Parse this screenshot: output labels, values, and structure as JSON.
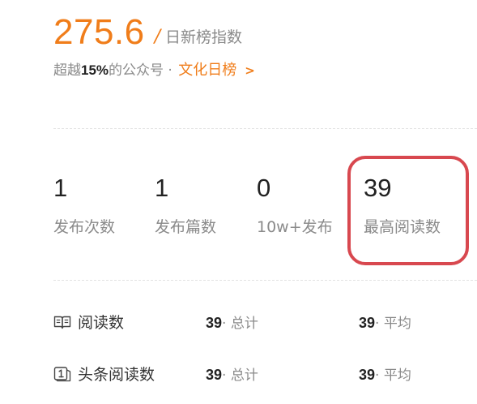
{
  "score": {
    "value": "275.6",
    "separator": "/",
    "label": "日新榜指数"
  },
  "rank": {
    "prefix": "超越",
    "percent": "15%",
    "suffix": "的公众号 · ",
    "category": "文化日榜",
    "arrow": ">"
  },
  "stats": [
    {
      "value": "1",
      "label": "发布次数"
    },
    {
      "value": "1",
      "label": "发布篇数"
    },
    {
      "value": "0",
      "label": "10w+发布"
    },
    {
      "value": "39",
      "label": "最高阅读数"
    }
  ],
  "highlight_color": "#d8484f",
  "accent_color": "#f07d1a",
  "metrics": [
    {
      "icon": "book-icon",
      "label": "阅读数",
      "total": "39",
      "total_unit": "· 总计",
      "avg": "39",
      "avg_unit": "· 平均"
    },
    {
      "icon": "headline-1-icon",
      "label": "头条阅读数",
      "total": "39",
      "total_unit": "· 总计",
      "avg": "39",
      "avg_unit": "· 平均"
    }
  ]
}
